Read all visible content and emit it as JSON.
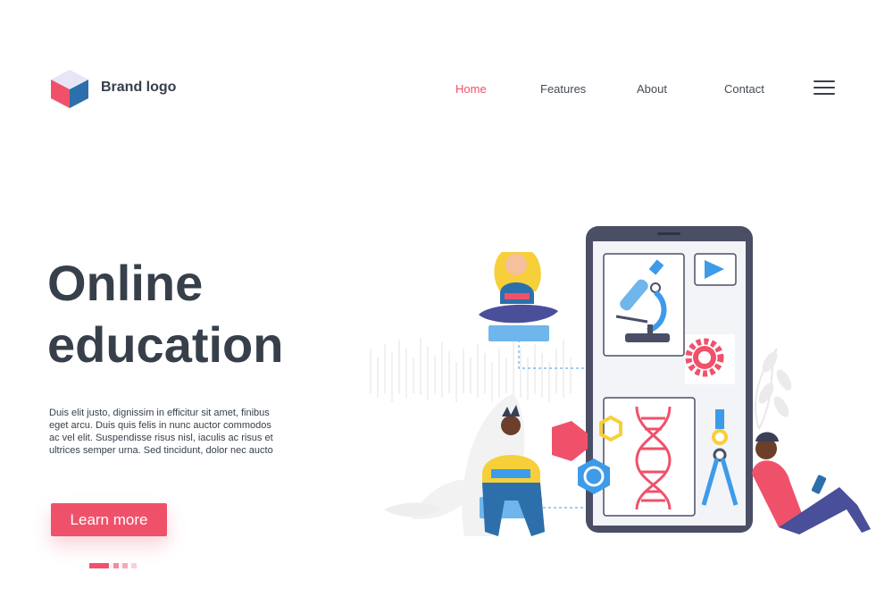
{
  "header": {
    "brand_label": "Brand logo",
    "nav": [
      {
        "label": "Home",
        "active": true
      },
      {
        "label": "Features",
        "active": false
      },
      {
        "label": "About",
        "active": false
      },
      {
        "label": "Contact",
        "active": false
      }
    ],
    "menu_icon": "hamburger-menu-icon"
  },
  "hero": {
    "title_line1": "Online",
    "title_line2": "education",
    "description": "Duis elit justo, dignissim in efficitur sit amet, finibus eget arcu. Duis quis felis in nunc auctor commodos ac vel elit. Suspendisse risus nisl, iaculis ac risus et ultrices semper urna. Sed tincidunt, dolor nec aucto",
    "cta_label": "Learn more"
  },
  "pagination": {
    "count": 4,
    "active_index": 0
  },
  "colors": {
    "accent": "#f0516a",
    "text": "#37404a",
    "phone_frame": "#4a4f66",
    "blue": "#3d9be9",
    "yellow": "#f7cf3a"
  },
  "illustration": {
    "icons": [
      "microscope-icon",
      "play-icon",
      "gear-icon",
      "dna-icon",
      "compass-icon",
      "hexagon-icon",
      "hex-nut-icon"
    ]
  }
}
